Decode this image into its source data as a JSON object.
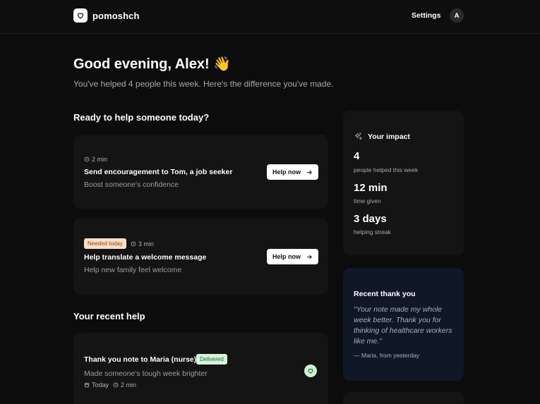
{
  "header": {
    "brand": "pomoshch",
    "settings_label": "Settings",
    "avatar_initial": "A"
  },
  "greeting": {
    "title": "Good evening, Alex! 👋",
    "subtitle": "You've helped 4 people this week. Here's the difference you've made."
  },
  "ready_section": {
    "title": "Ready to help someone today?",
    "tasks": [
      {
        "badge": "",
        "duration": "2 min",
        "title": "Send encouragement to Tom, a job seeker",
        "description": "Boost someone's confidence",
        "button_label": "Help now"
      },
      {
        "badge": "Needed today",
        "duration": "3 min",
        "title": "Help translate a welcome message",
        "description": "Help new family feel welcome",
        "button_label": "Help now"
      }
    ]
  },
  "recent_section": {
    "title": "Your recent help",
    "items": [
      {
        "title": "Thank you note to Maria (nurse)",
        "status": "Delivered",
        "description": "Made someone's tough week brighter",
        "date": "Today",
        "duration": "2 min"
      }
    ]
  },
  "impact": {
    "title": "Your impact",
    "stats": [
      {
        "value": "4",
        "label": "people helped this week"
      },
      {
        "value": "12 min",
        "label": "time given"
      },
      {
        "value": "3 days",
        "label": "helping streak"
      }
    ]
  },
  "thank_you": {
    "title": "Recent thank you",
    "quote": "\"Your note made my whole week better. Thank you for thinking of healthcare workers like me.\"",
    "from": "— Maria, from yesterday"
  },
  "colors": {
    "background": "#0c0c0c",
    "card": "#141414",
    "thanks_card": "#101828",
    "badge_needed": "#f7dfc7",
    "badge_delivered": "#d7f2da"
  }
}
